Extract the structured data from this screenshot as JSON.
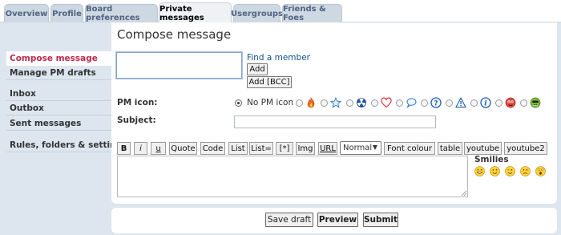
{
  "tabs": [
    "Overview",
    "Profile",
    "Board preferences",
    "Private messages",
    "Usergroups",
    "Friends & Foes"
  ],
  "active_tab": "Private messages",
  "page_title": "Compose message",
  "menu": {
    "items": [
      "Compose message",
      "Manage PM drafts",
      "Inbox",
      "Outbox",
      "Sent messages",
      "Rules, folders & settings"
    ],
    "active": "Compose message"
  },
  "recipients": {
    "value": "",
    "find_member_label": "Find a member",
    "add_label": "Add",
    "add_bcc_label": "Add [BCC]"
  },
  "pm_icon": {
    "label": "PM icon:",
    "no_icon_label": "No PM icon",
    "selected": "no-pm-icon",
    "icons": [
      "fire-icon",
      "star-icon",
      "radioactive-icon",
      "heart-icon",
      "speech-bubble-icon",
      "question-icon",
      "warning-icon",
      "info-icon",
      "red-face-icon",
      "alien-icon"
    ]
  },
  "subject": {
    "label": "Subject:",
    "value": ""
  },
  "toolbar": {
    "bold": "B",
    "italic": "i",
    "underline": "u",
    "quote": "Quote",
    "code": "Code",
    "list": "List",
    "list_ordered": "List=",
    "list_item": "[*]",
    "img": "Img",
    "url": "URL",
    "font_size_selected": "Normal",
    "font_colour": "Font colour",
    "table": "table",
    "youtube": "youtube",
    "youtube2": "youtube2"
  },
  "message": {
    "value": ""
  },
  "smilies": {
    "title": "Smilies",
    "items": [
      "big-grin-smiley-icon",
      "smile-smiley-icon",
      "wink-smiley-icon",
      "sad-smiley-icon",
      "surprised-smiley-icon"
    ]
  },
  "footer": {
    "save_draft": "Save draft",
    "preview": "Preview",
    "submit": "Submit"
  },
  "colors": {
    "tab_bg": "#cdd8e2",
    "page_bg": "#dde6ee",
    "active_menu_text": "#bc2a4d",
    "link": "#105289"
  }
}
